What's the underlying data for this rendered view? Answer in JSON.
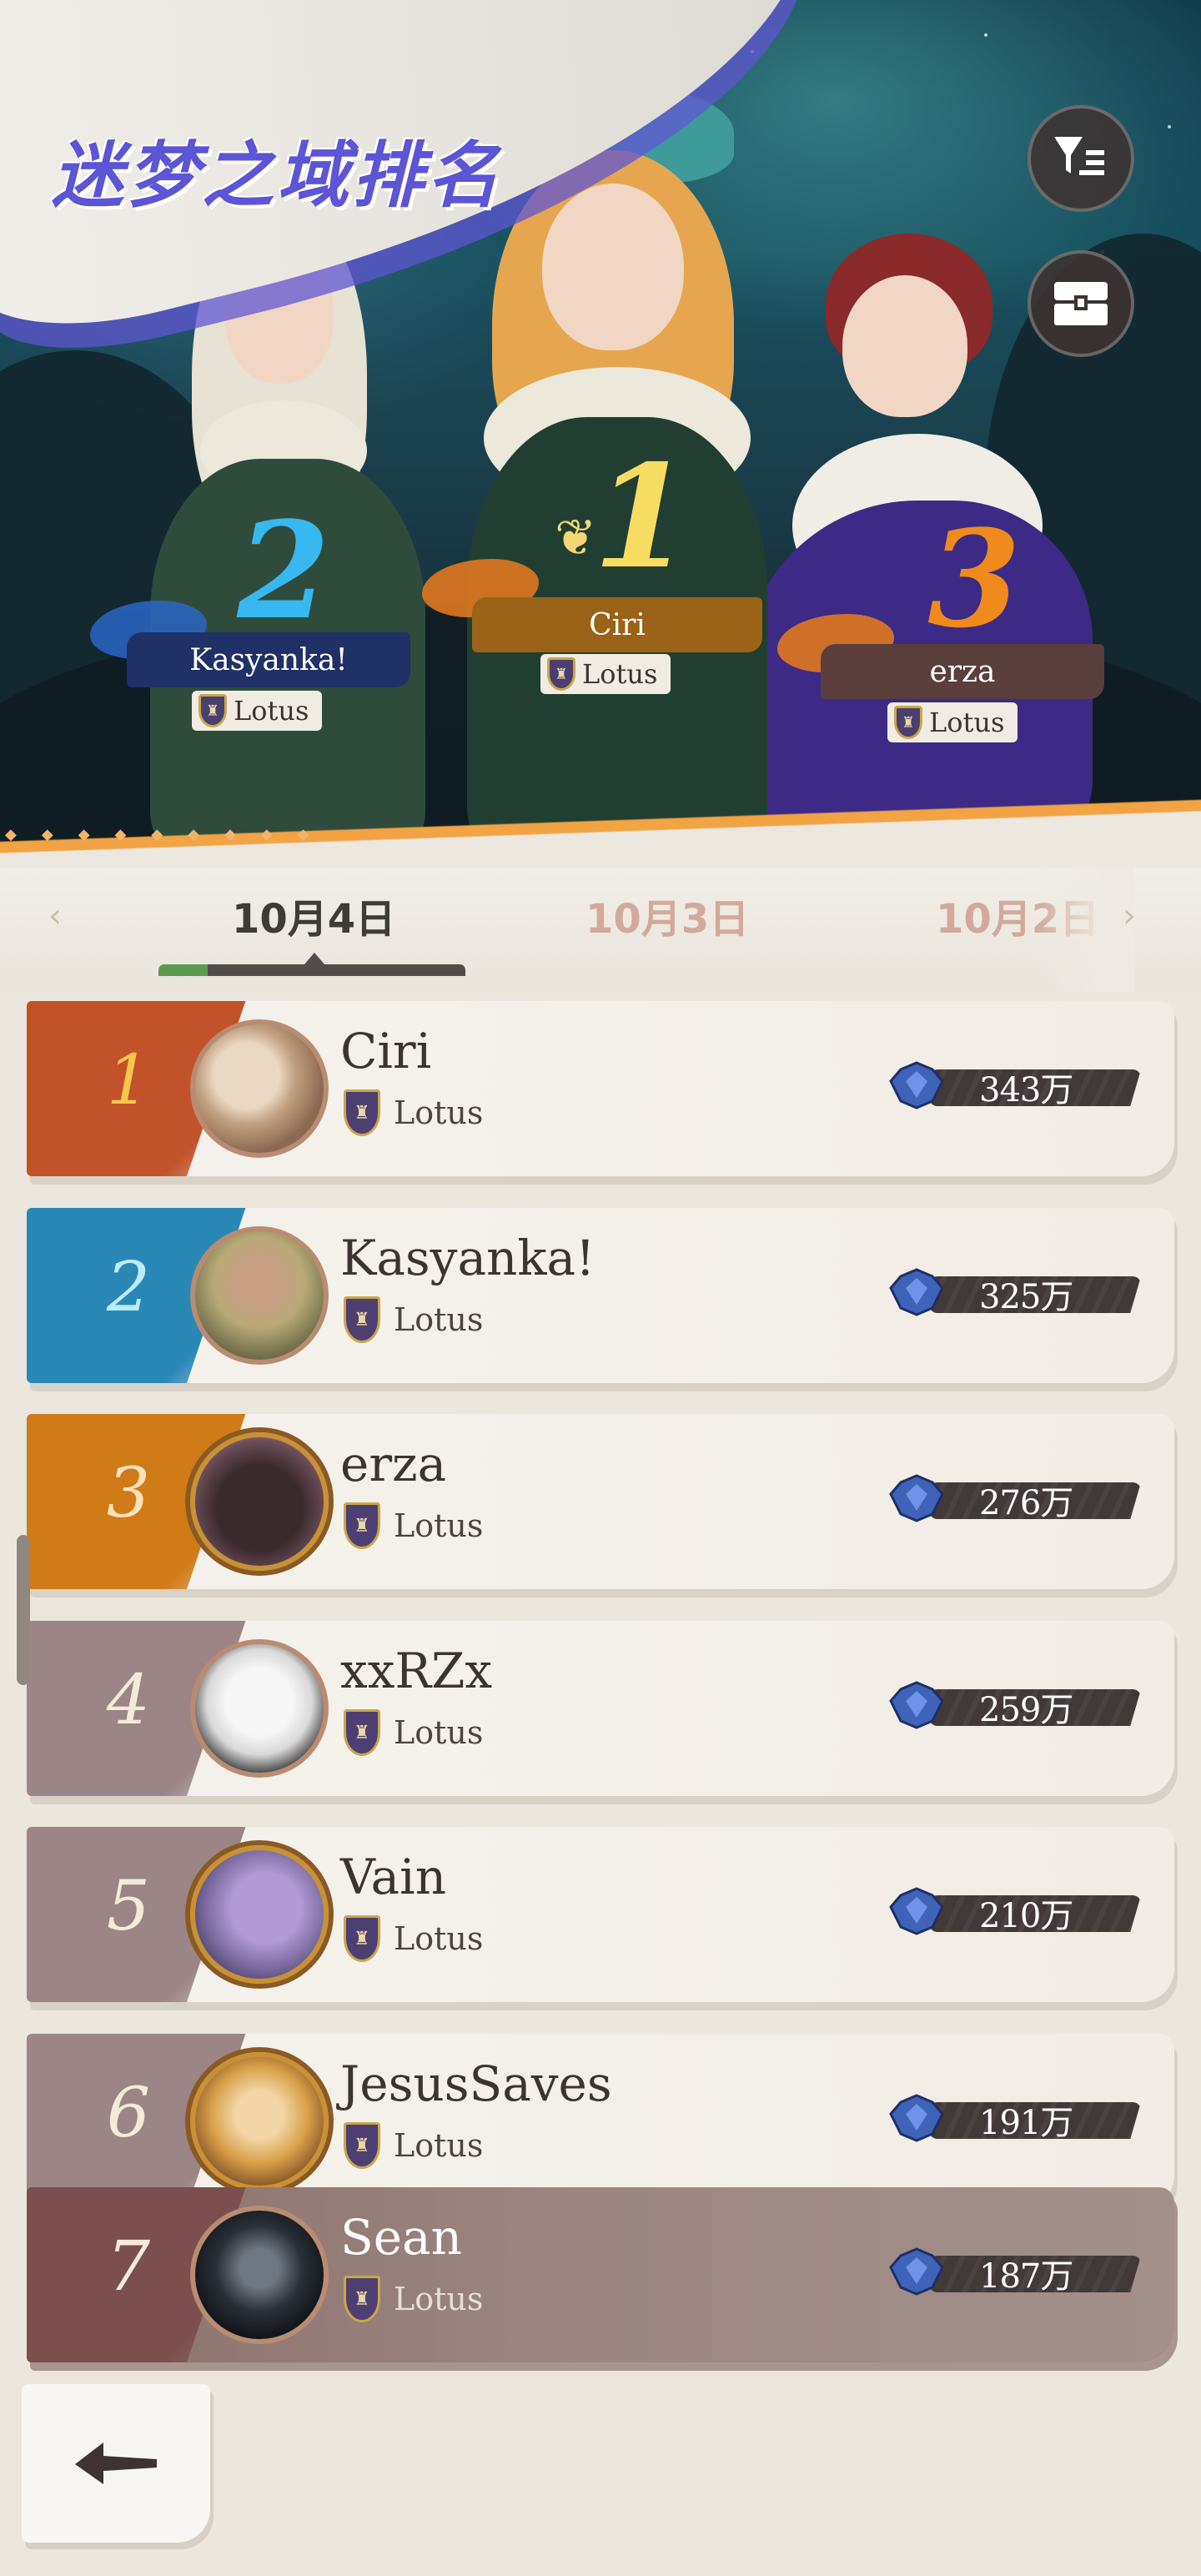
{
  "header": {
    "title": "迷梦之域排名",
    "filter_icon": "filter-list-icon",
    "reward_icon": "treasure-chest-icon"
  },
  "podium": [
    {
      "rank": "2",
      "name": "Kasyanka!",
      "guild": "Lotus",
      "accent": "#38b8f0",
      "plate": "#1f3166"
    },
    {
      "rank": "1",
      "name": "Ciri",
      "guild": "Lotus",
      "accent": "#f6dd62",
      "plate": "#9a6318"
    },
    {
      "rank": "3",
      "name": "erza",
      "guild": "Lotus",
      "accent": "#f08a1c",
      "plate": "#5a3f3c"
    }
  ],
  "tabs": [
    {
      "label": "10月4日",
      "active": true
    },
    {
      "label": "10月3日",
      "active": false
    },
    {
      "label": "10月2日",
      "active": false
    }
  ],
  "leaderboard": [
    {
      "rank": "1",
      "name": "Ciri",
      "guild": "Lotus",
      "score": "343万",
      "rank_color": "#c2522a"
    },
    {
      "rank": "2",
      "name": "Kasyanka!",
      "guild": "Lotus",
      "score": "325万",
      "rank_color": "#2a88b7"
    },
    {
      "rank": "3",
      "name": "erza",
      "guild": "Lotus",
      "score": "276万",
      "rank_color": "#d07b18"
    },
    {
      "rank": "4",
      "name": "xxRZx",
      "guild": "Lotus",
      "score": "259万",
      "rank_color": "#9b8586"
    },
    {
      "rank": "5",
      "name": "Vain",
      "guild": "Lotus",
      "score": "210万",
      "rank_color": "#9b8586"
    },
    {
      "rank": "6",
      "name": "JesusSaves",
      "guild": "Lotus",
      "score": "191万",
      "rank_color": "#9b8586"
    },
    {
      "rank": "7",
      "name": "Sean",
      "guild": "Lotus",
      "score": "187万",
      "rank_color": "#7a4f4e",
      "is_self": true
    }
  ],
  "footer": {
    "back_icon": "back-arrow-icon"
  },
  "colors": {
    "title": "#5c55d6",
    "accent_orange": "#f2a343",
    "active_tab_green": "#5a9a52"
  }
}
